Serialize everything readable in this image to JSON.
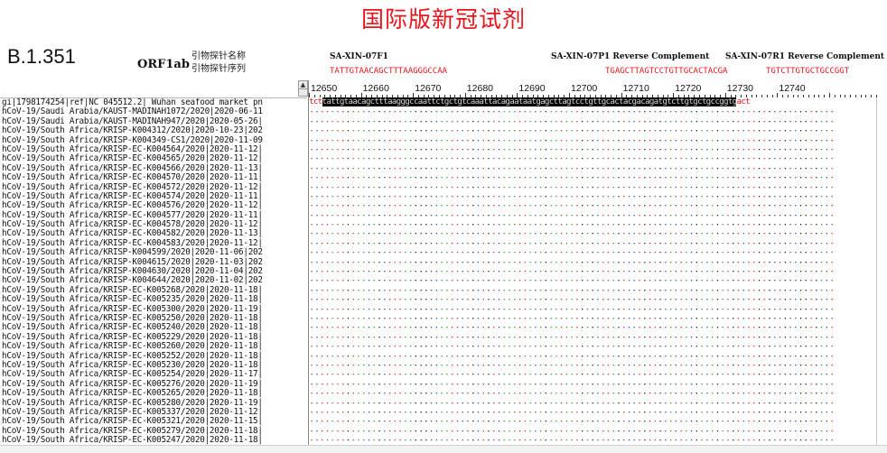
{
  "title": "国际版新冠试剂",
  "variant": "B.1.351",
  "gene": "ORF1ab",
  "legend": [
    "引物探针名称",
    "引物探针序列"
  ],
  "probes": [
    {
      "name": "SA-XIN-07F1",
      "seq": "TATTGTAACAGCTTTAAGGGCCAA"
    },
    {
      "name": "SA-XIN-07P1 Reverse Complement",
      "seq": "TGAGCTTAGTCCTGTTGCACTACGA"
    },
    {
      "name": "SA-XIN-07R1 Reverse Complement",
      "seq": "TGTCTTGTGCTGCCGGT"
    }
  ],
  "scroll_arrow": "▲",
  "ruler": [
    "12650",
    "12660",
    "12670",
    "12680",
    "12690",
    "12700",
    "12710",
    "12720",
    "12730",
    "12740"
  ],
  "reference": {
    "name": "gi|1798174254|ref|NC 045512.2| Wuhan seafood market pn",
    "prefix": "tct",
    "highlight": "tattgtaacagctttaagggccaattctgctgtcaaattacagaataatgagcttagtcctgttgcactacgacagatgtcttgtgctgccggtg",
    "suffix": "act"
  },
  "sequences": [
    "hCoV-19/Saudi Arabia/KAUST-MADINAH1072/2020|2020-06-11",
    "hCoV-19/Saudi Arabia/KAUST-MADINAH947/2020|2020-05-26|",
    "hCoV-19/South Africa/KRISP-K004312/2020|2020-10-23|202",
    "hCoV-19/South Africa/KRISP-K004349-CS1/2020|2020-11-09",
    "hCoV-19/South Africa/KRISP-EC-K004564/2020|2020-11-12|",
    "hCoV-19/South Africa/KRISP-EC-K004565/2020|2020-11-12|",
    "hCoV-19/South Africa/KRISP-EC-K004566/2020|2020-11-13|",
    "hCoV-19/South Africa/KRISP-EC-K004570/2020|2020-11-11|",
    "hCoV-19/South Africa/KRISP-EC-K004572/2020|2020-11-12|",
    "hCoV-19/South Africa/KRISP-EC-K004574/2020|2020-11-11|",
    "hCoV-19/South Africa/KRISP-EC-K004576/2020|2020-11-12|",
    "hCoV-19/South Africa/KRISP-EC-K004577/2020|2020-11-11|",
    "hCoV-19/South Africa/KRISP-EC-K004578/2020|2020-11-12|",
    "hCoV-19/South Africa/KRISP-EC-K004582/2020|2020-11-13|",
    "hCoV-19/South Africa/KRISP-EC-K004583/2020|2020-11-12|",
    "hCoV-19/South Africa/KRISP-K004599/2020|2020-11-06|202",
    "hCoV-19/South Africa/KRISP-K004615/2020|2020-11-03|202",
    "hCoV-19/South Africa/KRISP-K004630/2020|2020-11-04|202",
    "hCoV-19/South Africa/KRISP-K004644/2020|2020-11-02|202",
    "hCoV-19/South Africa/KRISP-EC-K005268/2020|2020-11-18|",
    "hCoV-19/South Africa/KRISP-EC-K005235/2020|2020-11-18|",
    "hCoV-19/South Africa/KRISP-EC-K005300/2020|2020-11-19|",
    "hCoV-19/South Africa/KRISP-EC-K005250/2020|2020-11-18|",
    "hCoV-19/South Africa/KRISP-EC-K005240/2020|2020-11-18|",
    "hCoV-19/South Africa/KRISP-EC-K005229/2020|2020-11-18|",
    "hCoV-19/South Africa/KRISP-EC-K005260/2020|2020-11-18|",
    "hCoV-19/South Africa/KRISP-EC-K005252/2020|2020-11-18|",
    "hCoV-19/South Africa/KRISP-EC-K005230/2020|2020-11-18|",
    "hCoV-19/South Africa/KRISP-EC-K005254/2020|2020-11-17|",
    "hCoV-19/South Africa/KRISP-EC-K005276/2020|2020-11-19|",
    "hCoV-19/South Africa/KRISP-EC-K005265/2020|2020-11-18|",
    "hCoV-19/South Africa/KRISP-EC-K005280/2020|2020-11-19|",
    "hCoV-19/South Africa/KRISP-EC-K005337/2020|2020-11-12|",
    "hCoV-19/South Africa/KRISP-EC-K005321/2020|2020-11-15|",
    "hCoV-19/South Africa/KRISP-EC-K005279/2020|2020-11-18|",
    "hCoV-19/South Africa/KRISP-EC-K005247/2020|2020-11-18|"
  ],
  "colors": {
    "title": "#e8141b",
    "probe_seq": "#e8141b",
    "a": "#2e9f2e",
    "c": "#2a4fd6",
    "g": "#222222",
    "t": "#e0302a"
  }
}
